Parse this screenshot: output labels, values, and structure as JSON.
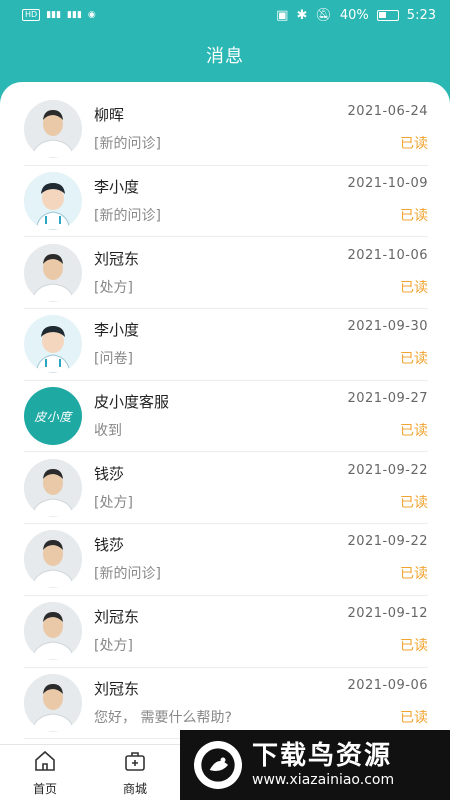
{
  "status_bar": {
    "left": [
      "HD",
      "⁴⁶",
      "⁴⁶"
    ],
    "battery": "40%",
    "time": "5:23"
  },
  "header": {
    "title": "消息"
  },
  "messages": [
    {
      "name": "柳晖",
      "date": "2021-06-24",
      "preview": "[新的问诊]",
      "status": "已读",
      "avatar": "photo"
    },
    {
      "name": "李小度",
      "date": "2021-10-09",
      "preview": "[新的问诊]",
      "status": "已读",
      "avatar": "cartoon"
    },
    {
      "name": "刘冠东",
      "date": "2021-10-06",
      "preview": "[处方]",
      "status": "已读",
      "avatar": "photo"
    },
    {
      "name": "李小度",
      "date": "2021-09-30",
      "preview": "[问卷]",
      "status": "已读",
      "avatar": "cartoon"
    },
    {
      "name": "皮小度客服",
      "date": "2021-09-27",
      "preview": "收到",
      "status": "已读",
      "avatar": "service"
    },
    {
      "name": "钱莎",
      "date": "2021-09-22",
      "preview": "[处方]",
      "status": "已读",
      "avatar": "photo"
    },
    {
      "name": "钱莎",
      "date": "2021-09-22",
      "preview": "[新的问诊]",
      "status": "已读",
      "avatar": "photo"
    },
    {
      "name": "刘冠东",
      "date": "2021-09-12",
      "preview": "[处方]",
      "status": "已读",
      "avatar": "photo"
    },
    {
      "name": "刘冠东",
      "date": "2021-09-06",
      "preview": "您好， 需要什么帮助?",
      "status": "已读",
      "avatar": "photo"
    }
  ],
  "service_avatar_text": "皮小度",
  "bottom_nav": [
    {
      "label": "首页",
      "icon": "home-icon"
    },
    {
      "label": "商城",
      "icon": "medical-kit-icon"
    }
  ],
  "watermark": {
    "title": "下载鸟资源",
    "url": "www.xiazainiao.com"
  },
  "colors": {
    "primary": "#2bb7b3",
    "read_status": "#f0a431"
  }
}
